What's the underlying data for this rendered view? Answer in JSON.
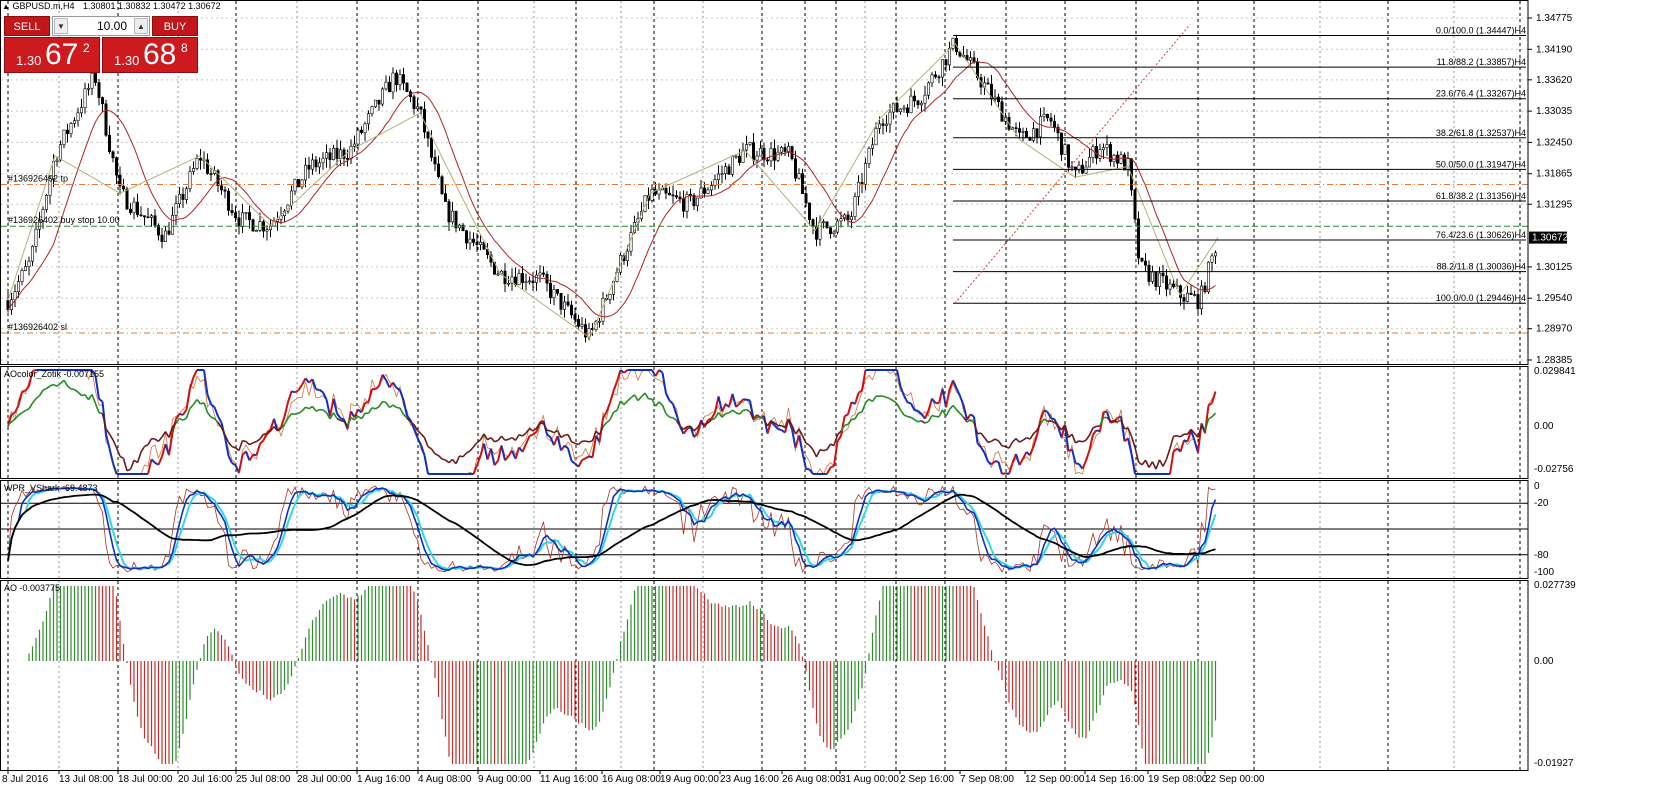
{
  "header": {
    "symbol_info": "GBPUSD.m,H4",
    "ohlc": "1.30801 1.30832 1.30472 1.30672"
  },
  "trade_panel": {
    "sell_label": "SELL",
    "buy_label": "BUY",
    "lot_value": "10.00",
    "sell_prefix": "1.30",
    "sell_big": "67",
    "sell_sup": "2",
    "buy_prefix": "1.30",
    "buy_big": "68",
    "buy_sup": "8"
  },
  "price_axis": [
    "1.34775",
    "1.34190",
    "1.33620",
    "1.33035",
    "1.32450",
    "1.31865",
    "1.31295",
    "1.30125",
    "1.29540",
    "1.28970",
    "1.28385"
  ],
  "current_price": "1.30672",
  "fib_levels": [
    {
      "label": "0.0/100.0 (1.34447)H4",
      "price": 1.34447
    },
    {
      "label": "11.8/88.2 (1.33857)H4",
      "price": 1.33857
    },
    {
      "label": "23.6/76.4 (1.33267)H4",
      "price": 1.33267
    },
    {
      "label": "38.2/61.8 (1.32537)H4",
      "price": 1.32537
    },
    {
      "label": "50.0/50.0 (1.31947)H4",
      "price": 1.31947
    },
    {
      "label": "61.8/38.2 (1.31356)H4",
      "price": 1.31356
    },
    {
      "label": "76.4/23.6 (1.30626)H4",
      "price": 1.30626
    },
    {
      "label": "88.2/11.8 (1.30036)H4",
      "price": 1.30036
    },
    {
      "label": "100.0/0.0 (1.29446)H4",
      "price": 1.29446
    }
  ],
  "order_lines": {
    "tp_label": "#136926402 tp",
    "buy_stop_label": "#136926402 buy stop 10.00",
    "sl_label": "#136926402 sl"
  },
  "indicators": {
    "ao_color": {
      "label": "AOcolor_Zotik -0.007155",
      "axis": [
        "0.029841",
        "0.00",
        "-0.02756"
      ]
    },
    "wpr": {
      "label": "WPR_VShark -69.4873",
      "axis": [
        "0",
        "-20",
        "-80",
        "-100"
      ]
    },
    "ao": {
      "label": "AO -0.003775",
      "axis": [
        "0.027739",
        "0.00",
        "-0.01927"
      ]
    }
  },
  "time_axis": [
    "8 Jul 2016",
    "13 Jul 08:00",
    "18 Jul 00:00",
    "20 Jul 16:00",
    "25 Jul 08:00",
    "28 Jul 00:00",
    "1 Aug 16:00",
    "4 Aug 08:00",
    "9 Aug 00:00",
    "11 Aug 16:00",
    "16 Aug 08:00",
    "19 Aug 00:00",
    "23 Aug 16:00",
    "26 Aug 08:00",
    "31 Aug 00:00",
    "2 Sep 16:00",
    "7 Sep 08:00",
    "12 Sep 00:00",
    "14 Sep 16:00",
    "19 Sep 08:00",
    "22 Sep 00:00"
  ],
  "colors": {
    "bull_bar": "#2e8b2e",
    "bear_bar": "#c23030",
    "ma": "#b22222",
    "fib": "#000000",
    "tp_sl": "#e07b39",
    "buy_stop": "#2e8b2e",
    "cyan": "#33d6e6",
    "blue": "#1030c0",
    "green": "#228b22"
  }
}
